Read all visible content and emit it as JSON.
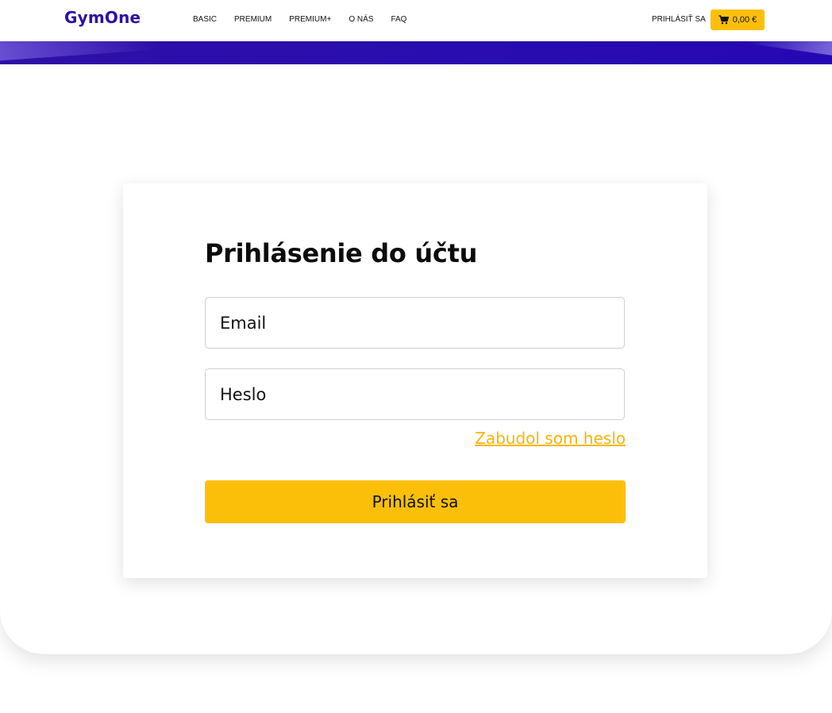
{
  "header": {
    "logo": "GymOne",
    "nav": [
      {
        "label": "BASIC"
      },
      {
        "label": "PREMIUM"
      },
      {
        "label": "PREMIUM+"
      },
      {
        "label": "O NÁS"
      },
      {
        "label": "FAQ"
      }
    ],
    "login_label": "PRIHLÁSIŤ SA",
    "cart": {
      "icon": "cart-icon",
      "value": "0,00 €"
    }
  },
  "login": {
    "title": "Prihlásenie do účtu",
    "email_placeholder": "Email",
    "password_placeholder": "Heslo",
    "forgot_label": "Zabudol som heslo",
    "submit_label": "Prihlásiť sa"
  },
  "colors": {
    "brand": "#2e12a3",
    "accent": "#fcbf09",
    "link": "#f7b500"
  }
}
